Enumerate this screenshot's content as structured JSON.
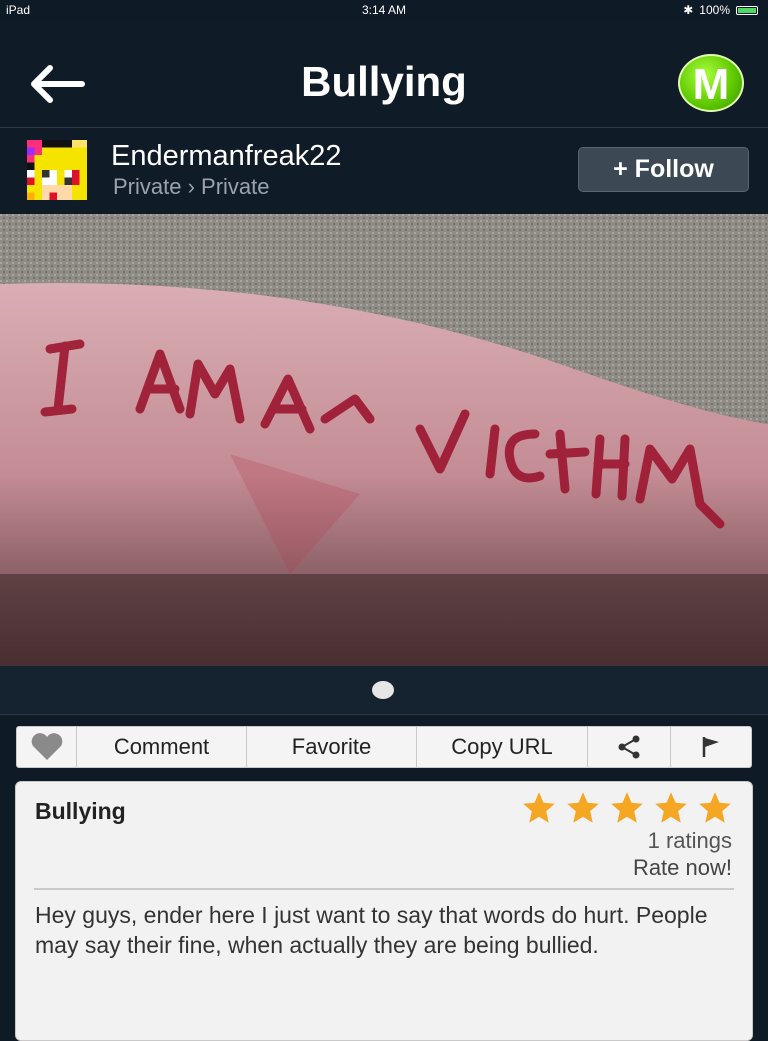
{
  "statusbar": {
    "device": "iPad",
    "time": "3:14 AM",
    "battery": "100%",
    "battery_level": 1.0
  },
  "nav": {
    "title": "Bullying",
    "logo_letter": "M"
  },
  "user": {
    "name": "Endermanfreak22",
    "breadcrumb": "Private › Private",
    "follow_label": "+ Follow"
  },
  "photo": {
    "pagination_current": 1,
    "pagination_total": 1
  },
  "actions": {
    "comment": "Comment",
    "favorite": "Favorite",
    "copy_url": "Copy URL"
  },
  "post": {
    "title": "Bullying",
    "star_count": 5,
    "rating_value": 5,
    "ratings_count": "1 ratings",
    "rate_now": "Rate now!",
    "description": "Hey guys, ender here I just want to say that words do hurt. People may say their fine, when actually they are being bullied."
  },
  "colors": {
    "navbar": "#101b28",
    "logo_green": "#5cc600",
    "star": "#f5a623"
  }
}
